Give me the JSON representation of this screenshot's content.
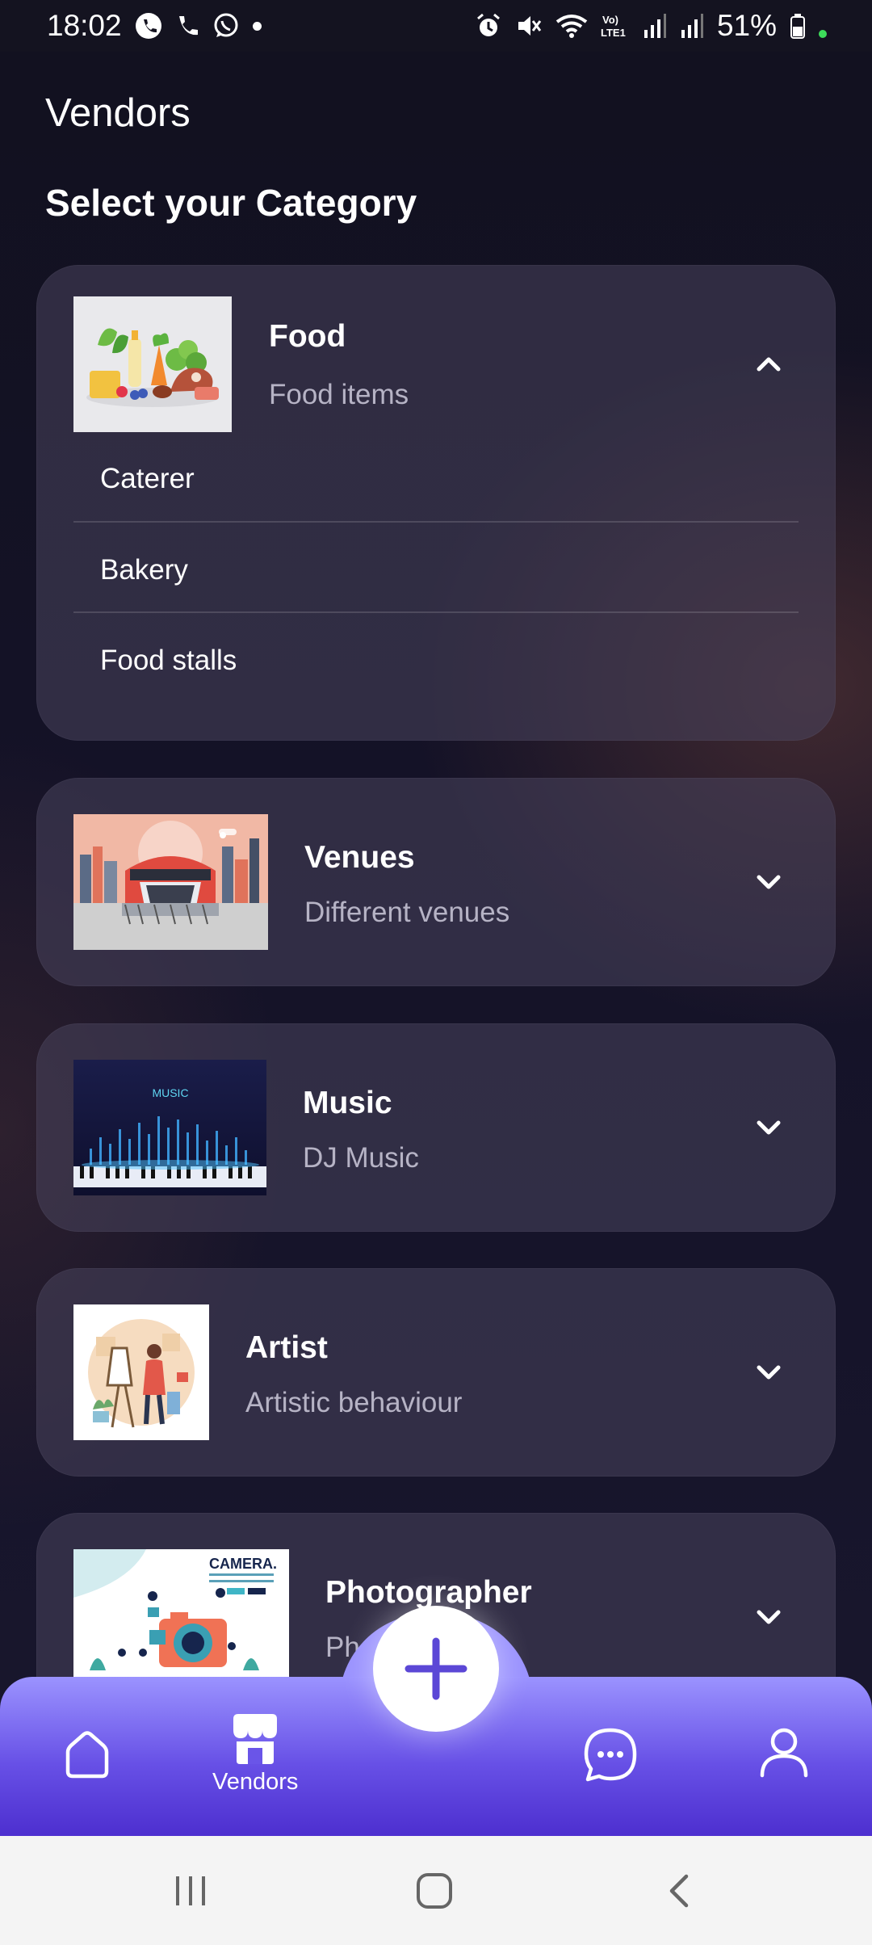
{
  "status_bar": {
    "time": "18:02",
    "battery": "51%"
  },
  "header": {
    "title": "Vendors",
    "subtitle": "Select your Category"
  },
  "categories": [
    {
      "title": "Food",
      "subtitle": "Food items",
      "expanded": true,
      "items": [
        "Caterer",
        "Bakery",
        "Food stalls"
      ]
    },
    {
      "title": "Venues",
      "subtitle": "Different venues",
      "expanded": false
    },
    {
      "title": "Music",
      "subtitle": "DJ Music",
      "expanded": false,
      "thumb_text": "MUSIC"
    },
    {
      "title": "Artist",
      "subtitle": "Artistic behaviour",
      "expanded": false
    },
    {
      "title": "Photographer",
      "subtitle": "Photographer",
      "expanded": false,
      "thumb_text": "CAMERA."
    }
  ],
  "bottom_nav": {
    "items": [
      {
        "icon": "home-icon",
        "label": ""
      },
      {
        "icon": "store-icon",
        "label": "Vendors"
      },
      {
        "icon": "chat-icon",
        "label": ""
      },
      {
        "icon": "profile-icon",
        "label": ""
      }
    ],
    "fab_icon": "plus-icon"
  },
  "colors": {
    "accent": "#6a55e8",
    "nav_top": "#9b93ff",
    "nav_bottom": "#4d2fcf"
  }
}
